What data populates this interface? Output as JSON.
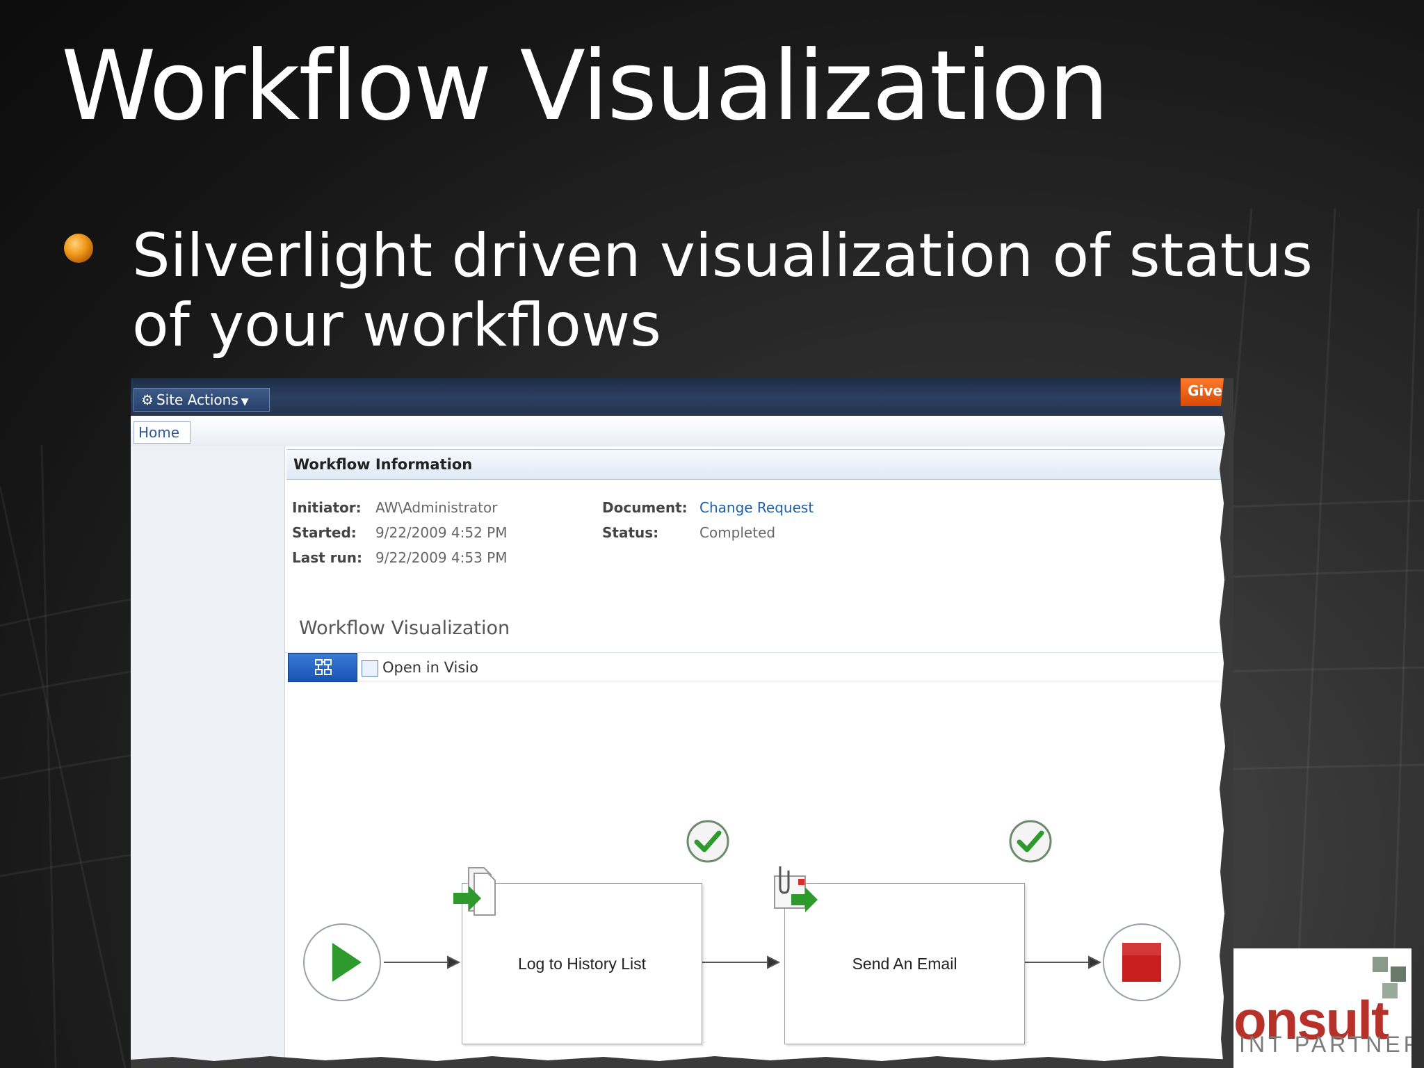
{
  "slide": {
    "title": "Workflow Visualization",
    "bullet": "Silverlight driven visualization of status of your workflows"
  },
  "sharepoint": {
    "site_actions_label": "Site Actions",
    "give_label": "Give",
    "breadcrumb_home": "Home",
    "panel_title": "Workflow Information",
    "info": {
      "initiator_label": "Initiator:",
      "initiator_value": "AW\\Administrator",
      "started_label": "Started:",
      "started_value": "9/22/2009 4:52 PM",
      "last_run_label": "Last run:",
      "last_run_value": "9/22/2009 4:53 PM",
      "document_label": "Document:",
      "document_value": "Change Request",
      "status_label": "Status:",
      "status_value": "Completed"
    },
    "viz_title": "Workflow Visualization",
    "open_in_visio": "Open in Visio",
    "steps": [
      {
        "label": "Log to History List",
        "status": "completed"
      },
      {
        "label": "Send An Email",
        "status": "completed"
      }
    ]
  },
  "logo": {
    "text": "onsult",
    "subtitle": "INT PARTNER"
  },
  "colors": {
    "accent_orange": "#f29a1c",
    "link_blue": "#1c5fa8",
    "check_green": "#2e9a2e",
    "stop_red": "#c81e1e",
    "logo_red": "#b5312a"
  }
}
